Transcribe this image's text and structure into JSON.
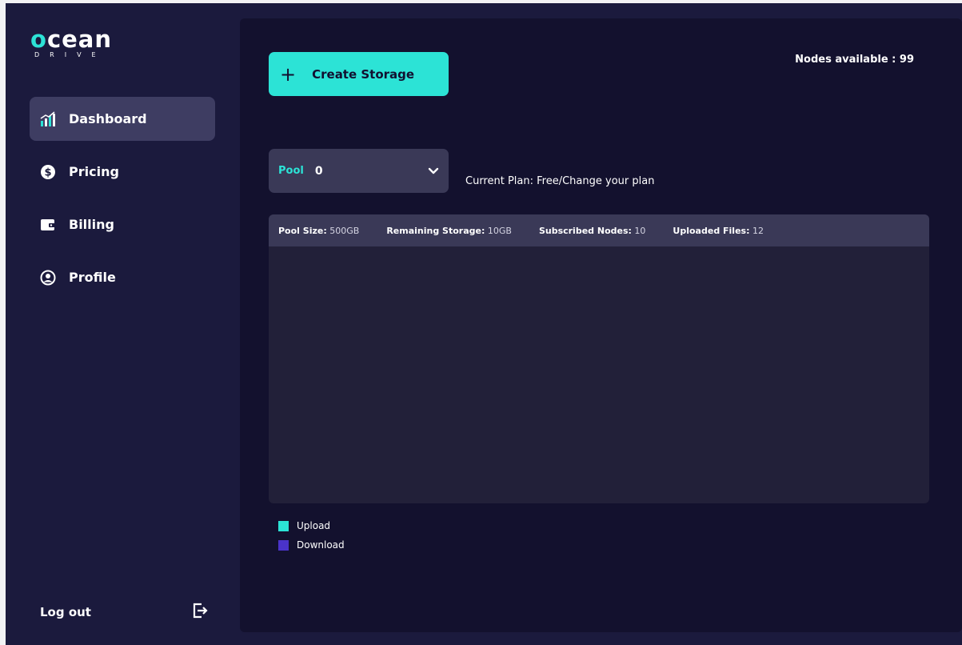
{
  "brand": {
    "word_prefix": "o",
    "word_rest": "cean",
    "subtitle": "DRIVE"
  },
  "sidebar": {
    "items": [
      {
        "label": "Dashboard",
        "icon": "chart-icon",
        "active": true
      },
      {
        "label": "Pricing",
        "icon": "dollar-icon",
        "active": false
      },
      {
        "label": "Billing",
        "icon": "wallet-icon",
        "active": false
      },
      {
        "label": "Profile",
        "icon": "user-icon",
        "active": false
      }
    ],
    "logout_label": "Log out"
  },
  "main": {
    "create_button_label": "Create Storage",
    "nodes_available": "Nodes available : 99",
    "pool_select": {
      "label": "Pool",
      "value": "0"
    },
    "current_plan": "Current Plan: Free/Change your plan",
    "stats": [
      {
        "label": "Pool Size:",
        "value": "500GB"
      },
      {
        "label": "Remaining Storage:",
        "value": "10GB"
      },
      {
        "label": "Subscribed Nodes:",
        "value": "10"
      },
      {
        "label": "Uploaded Files:",
        "value": "12"
      }
    ],
    "legend": [
      {
        "label": "Upload",
        "color": "#2ce3d6"
      },
      {
        "label": "Download",
        "color": "#4a33c9"
      }
    ]
  },
  "colors": {
    "accent": "#2ce3d6",
    "sidebar_bg": "#1b1a3d",
    "main_bg": "#13112e",
    "panel_bg": "#222039",
    "active_item_bg": "#3e3d62"
  }
}
